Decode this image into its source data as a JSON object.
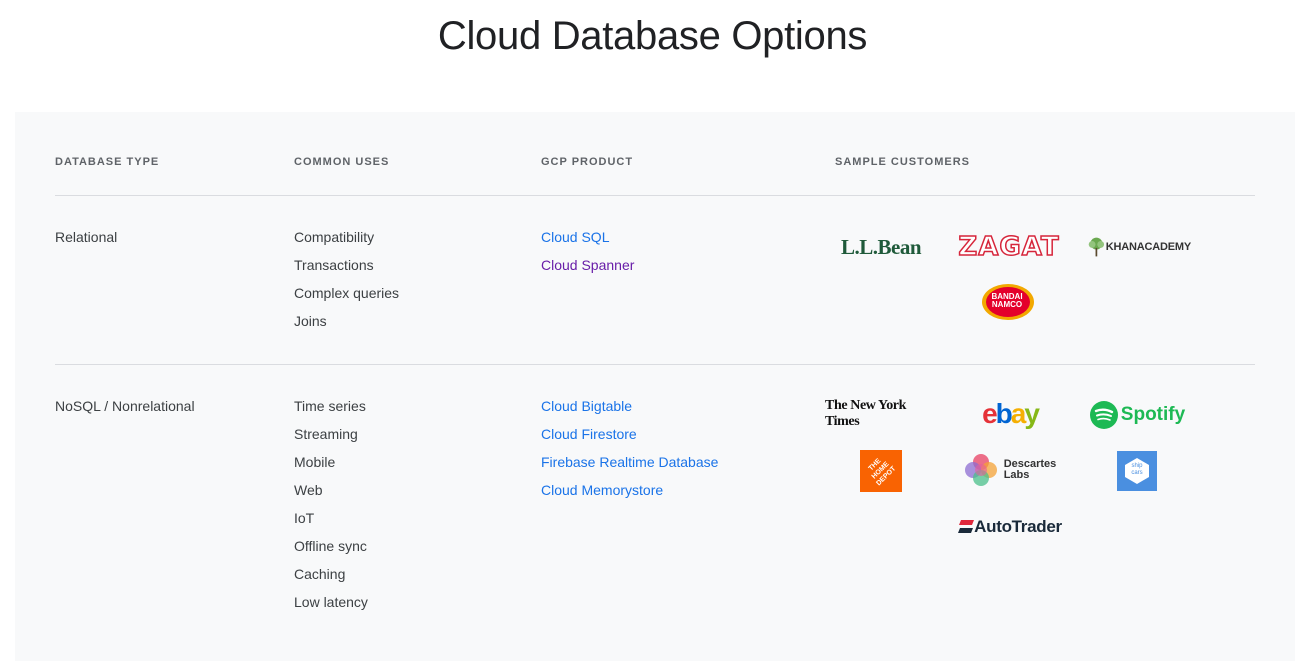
{
  "title": "Cloud Database Options",
  "headers": {
    "db_type": "DATABASE TYPE",
    "uses": "COMMON USES",
    "product": "GCP PRODUCT",
    "customers": "SAMPLE CUSTOMERS"
  },
  "rows": [
    {
      "type": "Relational",
      "uses": [
        "Compatibility",
        "Transactions",
        "Complex queries",
        "Joins"
      ],
      "products": [
        "Cloud SQL",
        "Cloud Spanner"
      ],
      "customers": [
        "L.L.Bean",
        "ZAGAT",
        "KHANACADEMY",
        "BANDAI NAMCO"
      ]
    },
    {
      "type": "NoSQL / Nonrelational",
      "uses": [
        "Time series",
        "Streaming",
        "Mobile",
        "Web",
        "IoT",
        "Offline sync",
        "Caching",
        "Low latency"
      ],
      "products": [
        "Cloud Bigtable",
        "Cloud Firestore",
        "Firebase Realtime Database",
        "Cloud Memorystore"
      ],
      "customers": [
        "The New York Times",
        "ebay",
        "Spotify",
        "THE HOME DEPOT",
        "Descartes",
        "Labs",
        "ship cars",
        "AutoTrader"
      ]
    }
  ],
  "colors": {
    "link": "#1a73e8",
    "visited_link": "#681da8",
    "panel_bg": "#f8f9fa",
    "divider": "#dadce0"
  }
}
